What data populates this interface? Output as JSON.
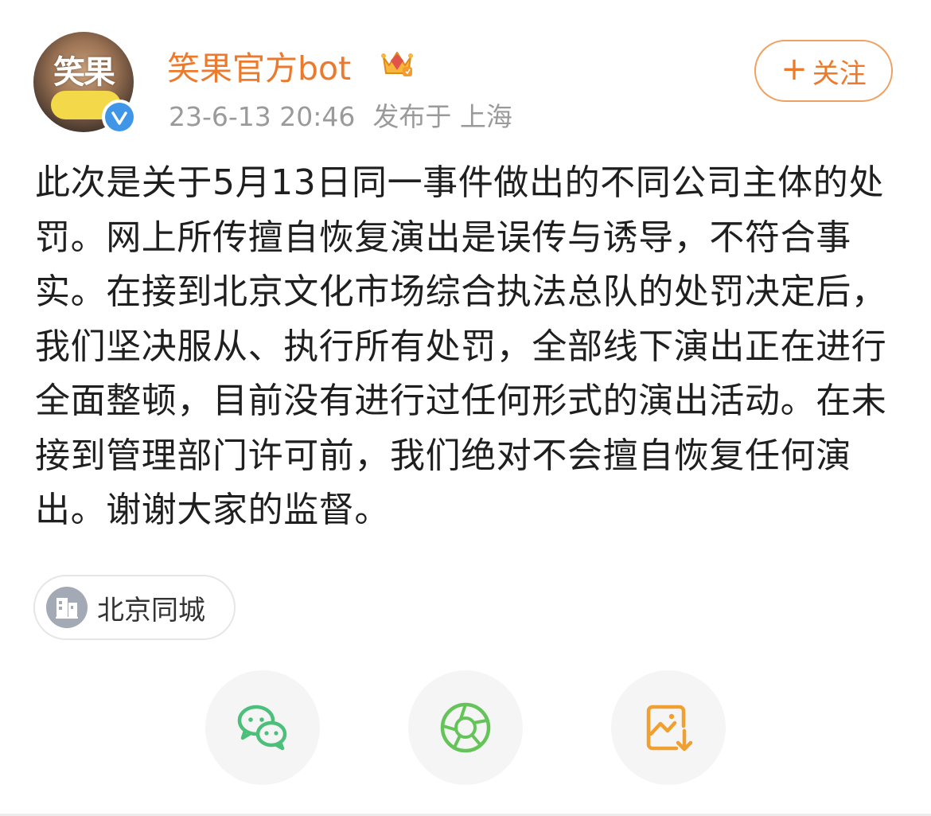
{
  "header": {
    "avatar_text": "笑果",
    "username": "笑果官方bot",
    "timestamp": "23-6-13 20:46",
    "location_label": "发布于 上海",
    "follow_label": "关注",
    "follow_plus": "+"
  },
  "post": {
    "text": "此次是关于5月13日同一事件做出的不同公司主体的处罚。网上所传擅自恢复演出是误传与诱导，不符合事实。在接到北京文化市场综合执法总队的处罚决定后，我们坚决服从、执行所有处罚，全部线下演出正在进行全面整顿，目前没有进行过任何形式的演出活动。在未接到管理部门许可前，我们绝对不会擅自恢复任何演出。谢谢大家的监督。"
  },
  "location_chip": {
    "label": "北京同城",
    "icon": "building-icon"
  },
  "share": {
    "items": [
      {
        "icon": "wechat-icon",
        "color": "#4cbf7a"
      },
      {
        "icon": "moments-icon",
        "color": "#64c459"
      },
      {
        "icon": "save-image-icon",
        "color": "#f0a030"
      }
    ]
  },
  "colors": {
    "accent": "#ec7a2c",
    "verified": "#3f95e8",
    "meta_text": "#9a9a9a"
  }
}
